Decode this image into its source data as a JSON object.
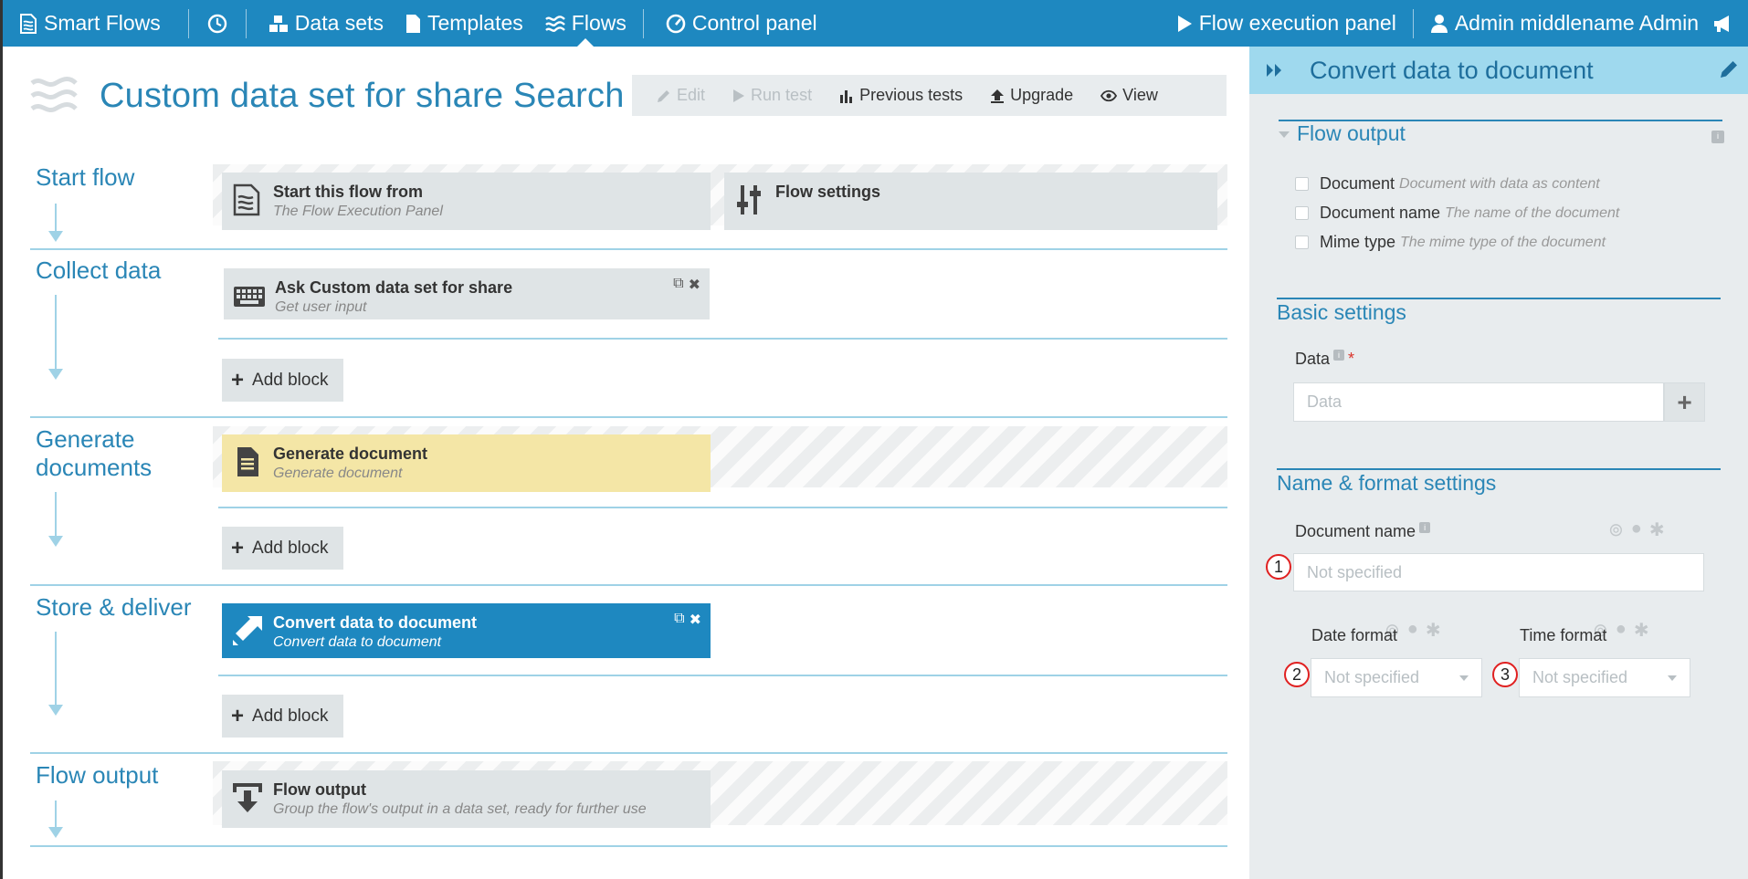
{
  "nav": {
    "brand": "Smart Flows",
    "items": [
      {
        "label": "Data sets"
      },
      {
        "label": "Templates"
      },
      {
        "label": "Flows"
      },
      {
        "label": "Control panel"
      }
    ],
    "execution": "Flow execution panel",
    "user": "Admin middlename Admin"
  },
  "page": {
    "title": "Custom data set for share Search",
    "toolbar": {
      "edit": "Edit",
      "run_test": "Run test",
      "previous_tests": "Previous tests",
      "upgrade": "Upgrade",
      "view": "View"
    }
  },
  "sections": {
    "start": {
      "label": "Start flow",
      "block1_title": "Start this flow from",
      "block1_sub": "The Flow Execution Panel",
      "block2_title": "Flow settings"
    },
    "collect": {
      "label": "Collect data",
      "block_title": "Ask Custom data set for share",
      "block_sub": "Get user input",
      "add": "Add block"
    },
    "generate": {
      "label_line1": "Generate",
      "label_line2": "documents",
      "block_title": "Generate document",
      "block_sub": "Generate document",
      "add": "Add block"
    },
    "store": {
      "label": "Store & deliver",
      "block_title": "Convert data to document",
      "block_sub": "Convert data to document",
      "add": "Add block"
    },
    "output": {
      "label": "Flow output",
      "block_title": "Flow output",
      "block_sub": "Group the flow's output in a data set, ready for further use"
    }
  },
  "panel": {
    "title": "Convert data to document",
    "flow_output": {
      "title": "Flow output",
      "rows": [
        {
          "name": "Document",
          "desc": "Document with data as content"
        },
        {
          "name": "Document name",
          "desc": "The name of the document"
        },
        {
          "name": "Mime type",
          "desc": "The mime type of the document"
        }
      ]
    },
    "basic": {
      "title": "Basic settings",
      "data_label": "Data",
      "required_mark": "*",
      "data_placeholder": "Data"
    },
    "name_format": {
      "title": "Name & format settings",
      "doc_name_label": "Document name",
      "doc_name_placeholder": "Not specified",
      "date_label": "Date format",
      "date_value": "Not specified",
      "time_label": "Time format",
      "time_value": "Not specified",
      "markers": [
        "1",
        "2",
        "3"
      ]
    }
  },
  "colors": {
    "nav_bg": "#1e88c0",
    "accent": "#2a86b6",
    "panel_head": "#9fd9ee",
    "generate_block": "#f4e6a6",
    "marker_ring": "#e02020"
  }
}
